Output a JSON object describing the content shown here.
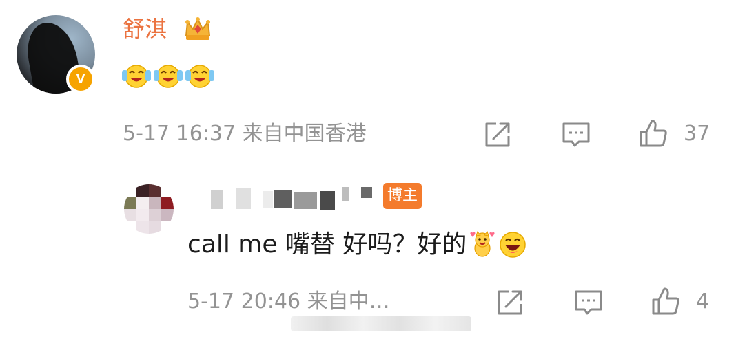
{
  "comment": {
    "username": "舒淇",
    "timestamp": "5-17 16:37",
    "location": "来自中国香港",
    "like_count": "37",
    "emojis": [
      "laugh-cry-emoji",
      "laugh-cry-emoji",
      "laugh-cry-emoji"
    ]
  },
  "reply": {
    "author_badge": "博主",
    "text": "call me 嘴替 好吗？好的",
    "timestamp": "5-17 20:46",
    "location": "来自中…",
    "like_count": "4"
  },
  "colors": {
    "username": "#eb7340",
    "author_badge": "#f47b2c",
    "meta_text": "#939393",
    "verified_badge": "#f6a300"
  }
}
